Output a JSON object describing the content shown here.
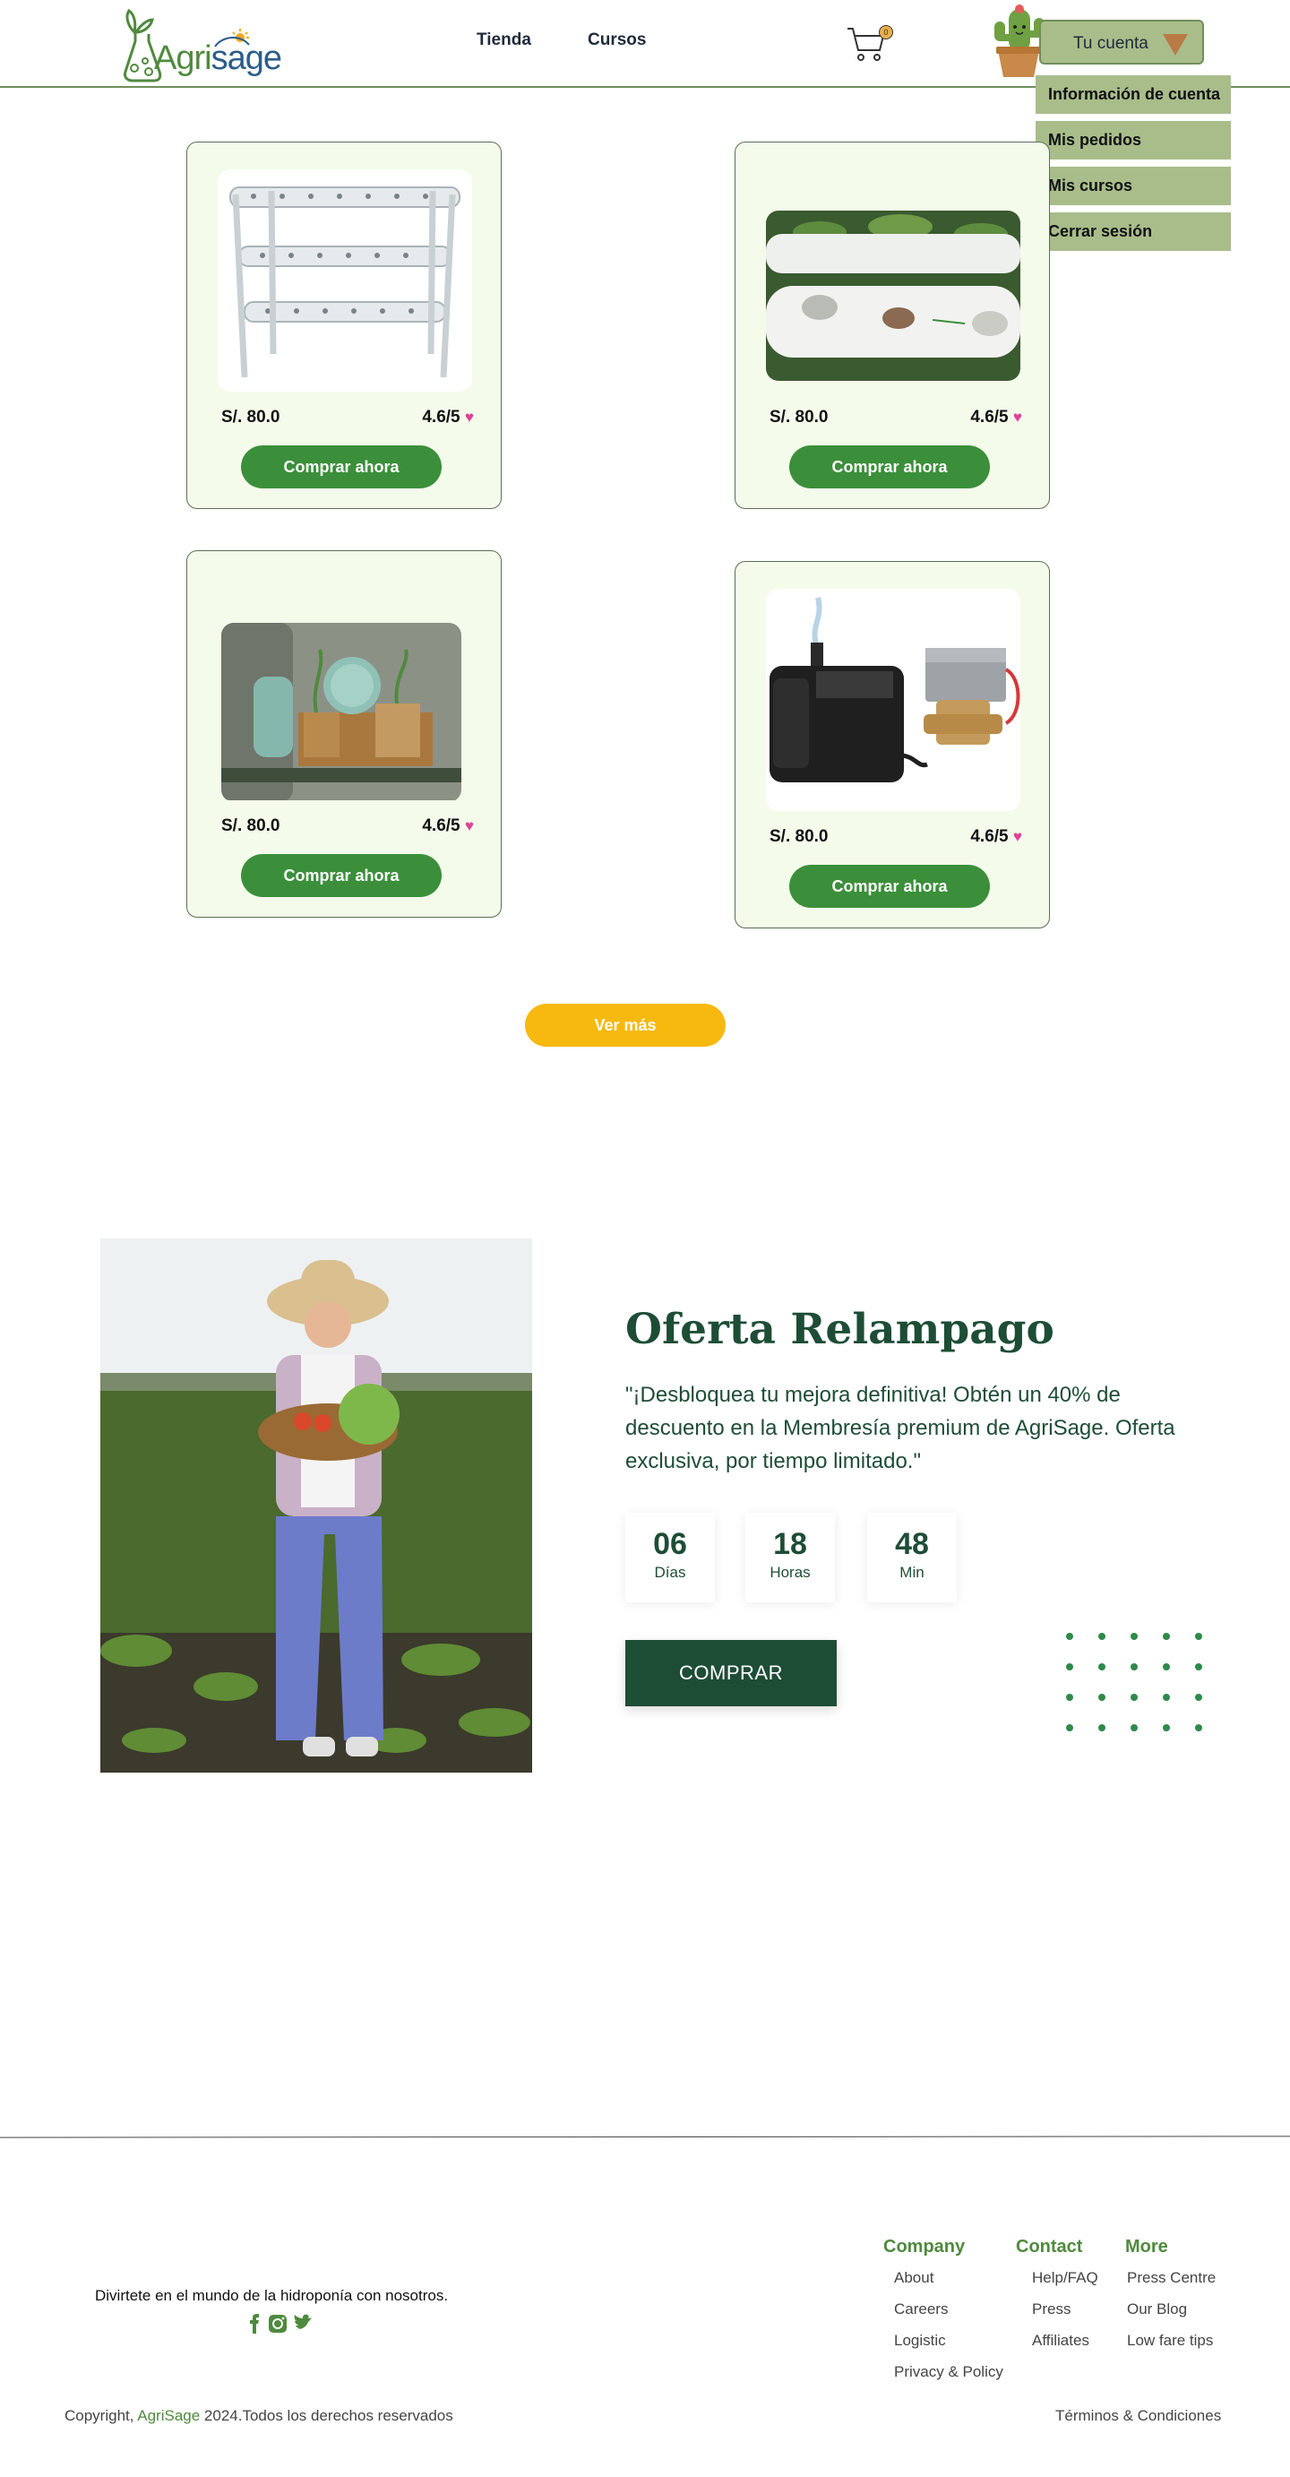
{
  "brand": {
    "logo_left": "Agri",
    "logo_right": "sage"
  },
  "nav": {
    "tienda": "Tienda",
    "cursos": "Cursos"
  },
  "cart": {
    "count": "0"
  },
  "account": {
    "label": "Tu cuenta",
    "menu": [
      "Información de cuenta",
      "Mis pedidos",
      "Mis cursos",
      "Cerrar sesión"
    ]
  },
  "products": [
    {
      "price": "S/. 80.0",
      "rating": "4.6/5",
      "button": "Comprar ahora",
      "image": "hydroponic-shelf"
    },
    {
      "price": "S/. 80.0",
      "rating": "4.6/5",
      "button": "Comprar ahora",
      "image": "hydroponic-pipe"
    },
    {
      "price": "S/. 80.0",
      "rating": "4.6/5",
      "button": "Comprar ahora",
      "image": "greenhouse-pots"
    },
    {
      "price": "S/. 80.0",
      "rating": "4.6/5",
      "button": "Comprar ahora",
      "image": "water-pump"
    }
  ],
  "ver_mas": "Ver más",
  "offer": {
    "title": "Oferta Relampago",
    "text": "\"¡Desbloquea tu mejora definitiva! Obtén un 40% de descuento en la Membresía premium de AgriSage. Oferta exclusiva, por tiempo limitado.\"",
    "countdown": [
      {
        "value": "06",
        "label": "Días"
      },
      {
        "value": "18",
        "label": "Horas"
      },
      {
        "value": "48",
        "label": "Min"
      }
    ],
    "button": "COMPRAR"
  },
  "footer": {
    "tagline": "Divirtete en el mundo de la hidroponía con nosotros.",
    "columns": [
      {
        "title": "Company",
        "links": [
          "About",
          "Careers",
          "Logistic",
          "Privacy & Policy"
        ]
      },
      {
        "title": "Contact",
        "links": [
          "Help/FAQ",
          "Press",
          "Affiliates"
        ]
      },
      {
        "title": "More",
        "links": [
          "Press Centre",
          "Our Blog",
          "Low fare tips"
        ]
      }
    ],
    "copyright_pre": "Copyright, ",
    "copyright_brand": "AgriSage",
    "copyright_post": " 2024.Todos los derechos reservados",
    "terms": "Términos & Condiciones"
  },
  "colors": {
    "accent": "#3b8f3a",
    "dark_green": "#1e4d36",
    "menu_green": "#a9bd8b",
    "yellow": "#f7b90f",
    "card_bg": "#f4fbeb"
  }
}
